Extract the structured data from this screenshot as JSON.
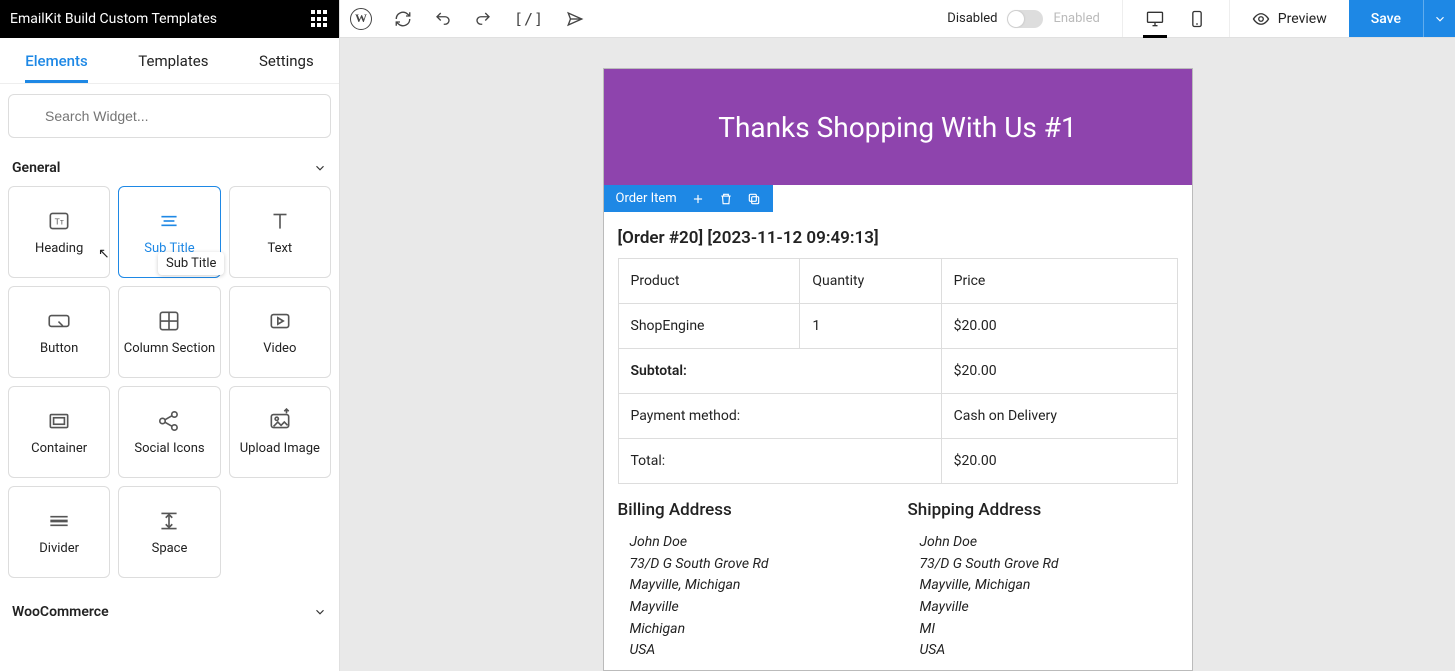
{
  "brand": "EmailKit Build Custom Templates",
  "tabs": {
    "elements": "Elements",
    "templates": "Templates",
    "settings": "Settings"
  },
  "search": {
    "placeholder": "Search Widget..."
  },
  "groups": {
    "general": "General",
    "woocommerce": "WooCommerce"
  },
  "widgets": {
    "heading": "Heading",
    "subtitle": "Sub Title",
    "text": "Text",
    "button": "Button",
    "columnsection": "Column Section",
    "video": "Video",
    "container": "Container",
    "socialicons": "Social Icons",
    "uploadimage": "Upload Image",
    "divider": "Divider",
    "space": "Space"
  },
  "tooltip": "Sub Title",
  "topbar": {
    "disabled": "Disabled",
    "enabled": "Enabled",
    "preview": "Preview",
    "save": "Save"
  },
  "email": {
    "headline": "Thanks Shopping With Us #1",
    "block_label": "Order Item",
    "order_title": "[Order #20] [2023-11-12 09:49:13]",
    "columns": {
      "product": "Product",
      "quantity": "Quantity",
      "price": "Price"
    },
    "row": {
      "product": "ShopEngine",
      "quantity": "1",
      "price": "$20.00"
    },
    "subtotal_label": "Subtotal:",
    "subtotal_value": "$20.00",
    "payment_label": "Payment method:",
    "payment_value": "Cash on Delivery",
    "total_label": "Total:",
    "total_value": "$20.00",
    "billing_title": "Billing Address",
    "shipping_title": "Shipping Address",
    "billing": [
      "John Doe",
      "73/D G South Grove Rd",
      "Mayville, Michigan",
      "Mayville",
      "Michigan",
      "USA"
    ],
    "shipping": [
      "John Doe",
      "73/D G South Grove Rd",
      "Mayville, Michigan",
      "Mayville",
      "MI",
      "USA"
    ]
  }
}
